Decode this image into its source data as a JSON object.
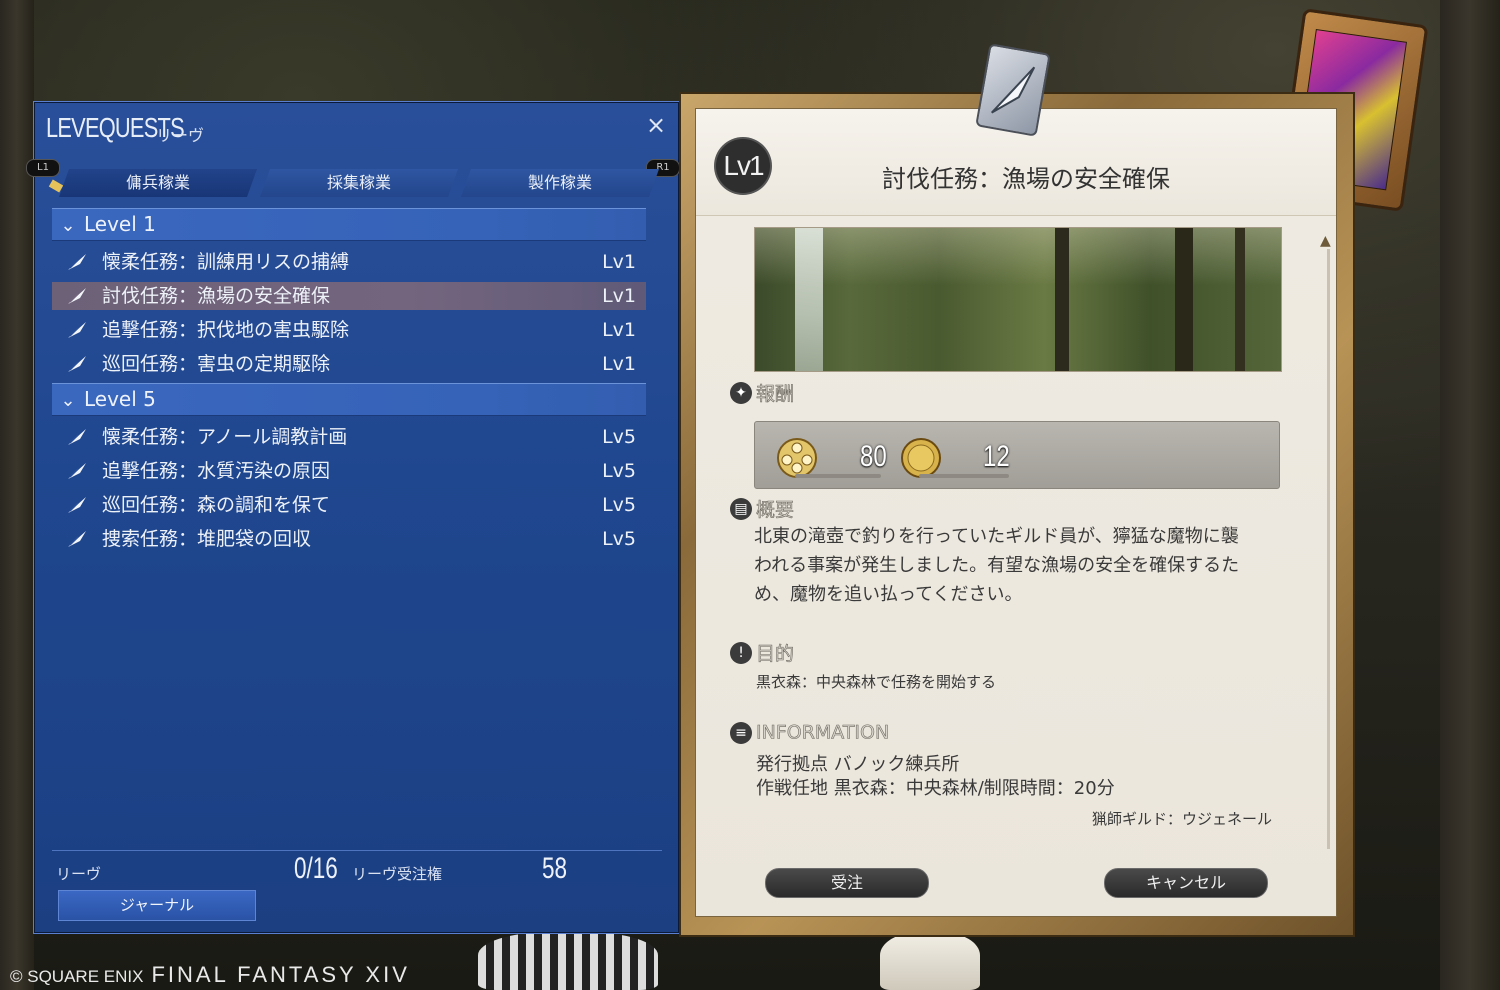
{
  "leve_window": {
    "title_en": "LEVEQUESTS",
    "title_jp": "リーヴ",
    "close_icon": "×",
    "shoulder_left": "L1",
    "shoulder_right": "R1",
    "tabs": [
      {
        "label": "傭兵稼業",
        "active": true
      },
      {
        "label": "採集稼業",
        "active": false
      },
      {
        "label": "製作稼業",
        "active": false
      }
    ],
    "groups": [
      {
        "header": "Level 1",
        "items": [
          {
            "name": "懐柔任務：訓練用リスの捕縛",
            "level": "Lv1",
            "selected": false
          },
          {
            "name": "討伐任務：漁場の安全確保",
            "level": "Lv1",
            "selected": true
          },
          {
            "name": "追撃任務：択伐地の害虫駆除",
            "level": "Lv1",
            "selected": false
          },
          {
            "name": "巡回任務：害虫の定期駆除",
            "level": "Lv1",
            "selected": false
          }
        ]
      },
      {
        "header": "Level 5",
        "items": [
          {
            "name": "懐柔任務：アノール調教計画",
            "level": "Lv5",
            "selected": false
          },
          {
            "name": "追撃任務：水質汚染の原因",
            "level": "Lv5",
            "selected": false
          },
          {
            "name": "巡回任務：森の調和を保て",
            "level": "Lv5",
            "selected": false
          },
          {
            "name": "捜索任務：堆肥袋の回収",
            "level": "Lv5",
            "selected": false
          }
        ]
      }
    ],
    "footer": {
      "leve_label": "リーヴ",
      "leve_count": "0/16",
      "allowance_label": "リーヴ受注権",
      "allowance_value": "58",
      "journal_button": "ジャーナル"
    }
  },
  "detail": {
    "level_badge": "Lv1",
    "title": "討伐任務：漁場の安全確保",
    "reward_heading": "報酬",
    "rewards": [
      {
        "icon": "seal-icon",
        "amount": "80"
      },
      {
        "icon": "gil-coin-icon",
        "amount": "12"
      }
    ],
    "summary_heading": "概要",
    "summary_lines": [
      "北東の滝壺で釣りを行っていたギルド員が、獰猛な魔物に襲",
      "われる事案が発生しました。有望な漁場の安全を確保するた",
      "め、魔物を追い払ってください。"
    ],
    "objective_heading": "目的",
    "objective_text": "黒衣森：中央森林で任務を開始する",
    "info_heading": "INFORMATION",
    "info_lines": [
      "発行拠点 バノック練兵所",
      "作戦任地 黒衣森：中央森林/制限時間：20分"
    ],
    "issuer": "猟師ギルド：ウジェネール",
    "accept_button": "受注",
    "cancel_button": "キャンセル"
  },
  "copyright": {
    "company": "© SQUARE ENIX",
    "game": "FINAL FANTASY XIV"
  },
  "colors": {
    "panel_blue": "#1f478f",
    "header_blue": "#3663b8",
    "selected_row": "#74657e",
    "parchment": "#ece7dd",
    "frame_gold": "#b89356"
  }
}
